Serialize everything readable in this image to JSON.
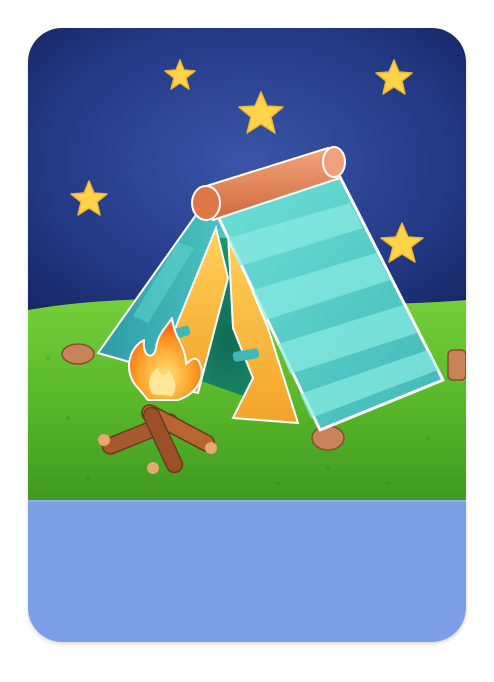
{
  "card": {
    "label": "",
    "panel_color": "#7b9ee6"
  },
  "scene": {
    "subject": "tent-icon",
    "elements": [
      "star-icon",
      "campfire-icon",
      "tent-icon"
    ],
    "colors": {
      "sky_top": "#1a2a6b",
      "sky_bottom": "#3a55a8",
      "grass": "#5cbf2a",
      "tent_fabric": "#5fd6cf",
      "tent_inner": "#f7b73a",
      "roll": "#e98b5e",
      "star": "#ffd44a",
      "fire": "#ff8a1c"
    }
  }
}
